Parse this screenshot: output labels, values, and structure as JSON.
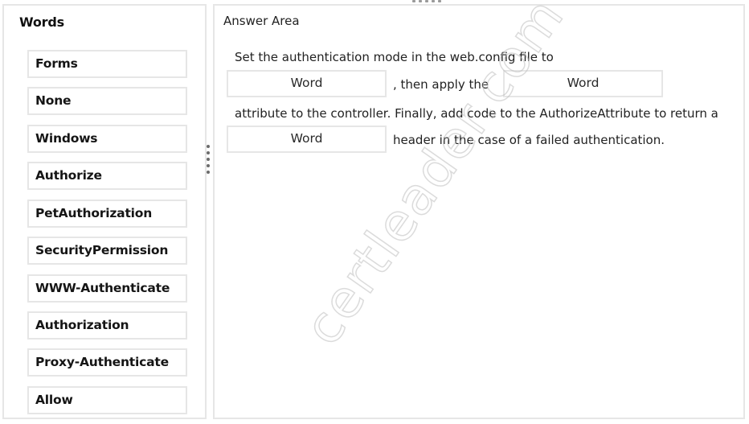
{
  "words_panel": {
    "title": "Words",
    "items": [
      {
        "label": "Forms"
      },
      {
        "label": "None"
      },
      {
        "label": "Windows"
      },
      {
        "label": "Authorize"
      },
      {
        "label": "PetAuthorization"
      },
      {
        "label": "SecurityPermission"
      },
      {
        "label": "WWW-Authenticate"
      },
      {
        "label": "Authorization"
      },
      {
        "label": "Proxy-Authenticate"
      },
      {
        "label": "Allow"
      }
    ]
  },
  "answer_area": {
    "title": "Answer Area",
    "line1": "Set the authentication mode in the web.config file to",
    "slot1": "Word",
    "line2_mid": ", then apply the",
    "slot2": "Word",
    "line3": "attribute to the controller. Finally, add code to the AuthorizeAttribute to return a",
    "slot3": "Word",
    "line4_end": "header in the case of a failed authentication."
  },
  "watermark": "certleader.com",
  "icons": {
    "splitter": "vertical-drag-handle-icon",
    "top_handle": "horizontal-drag-handle-icon"
  }
}
